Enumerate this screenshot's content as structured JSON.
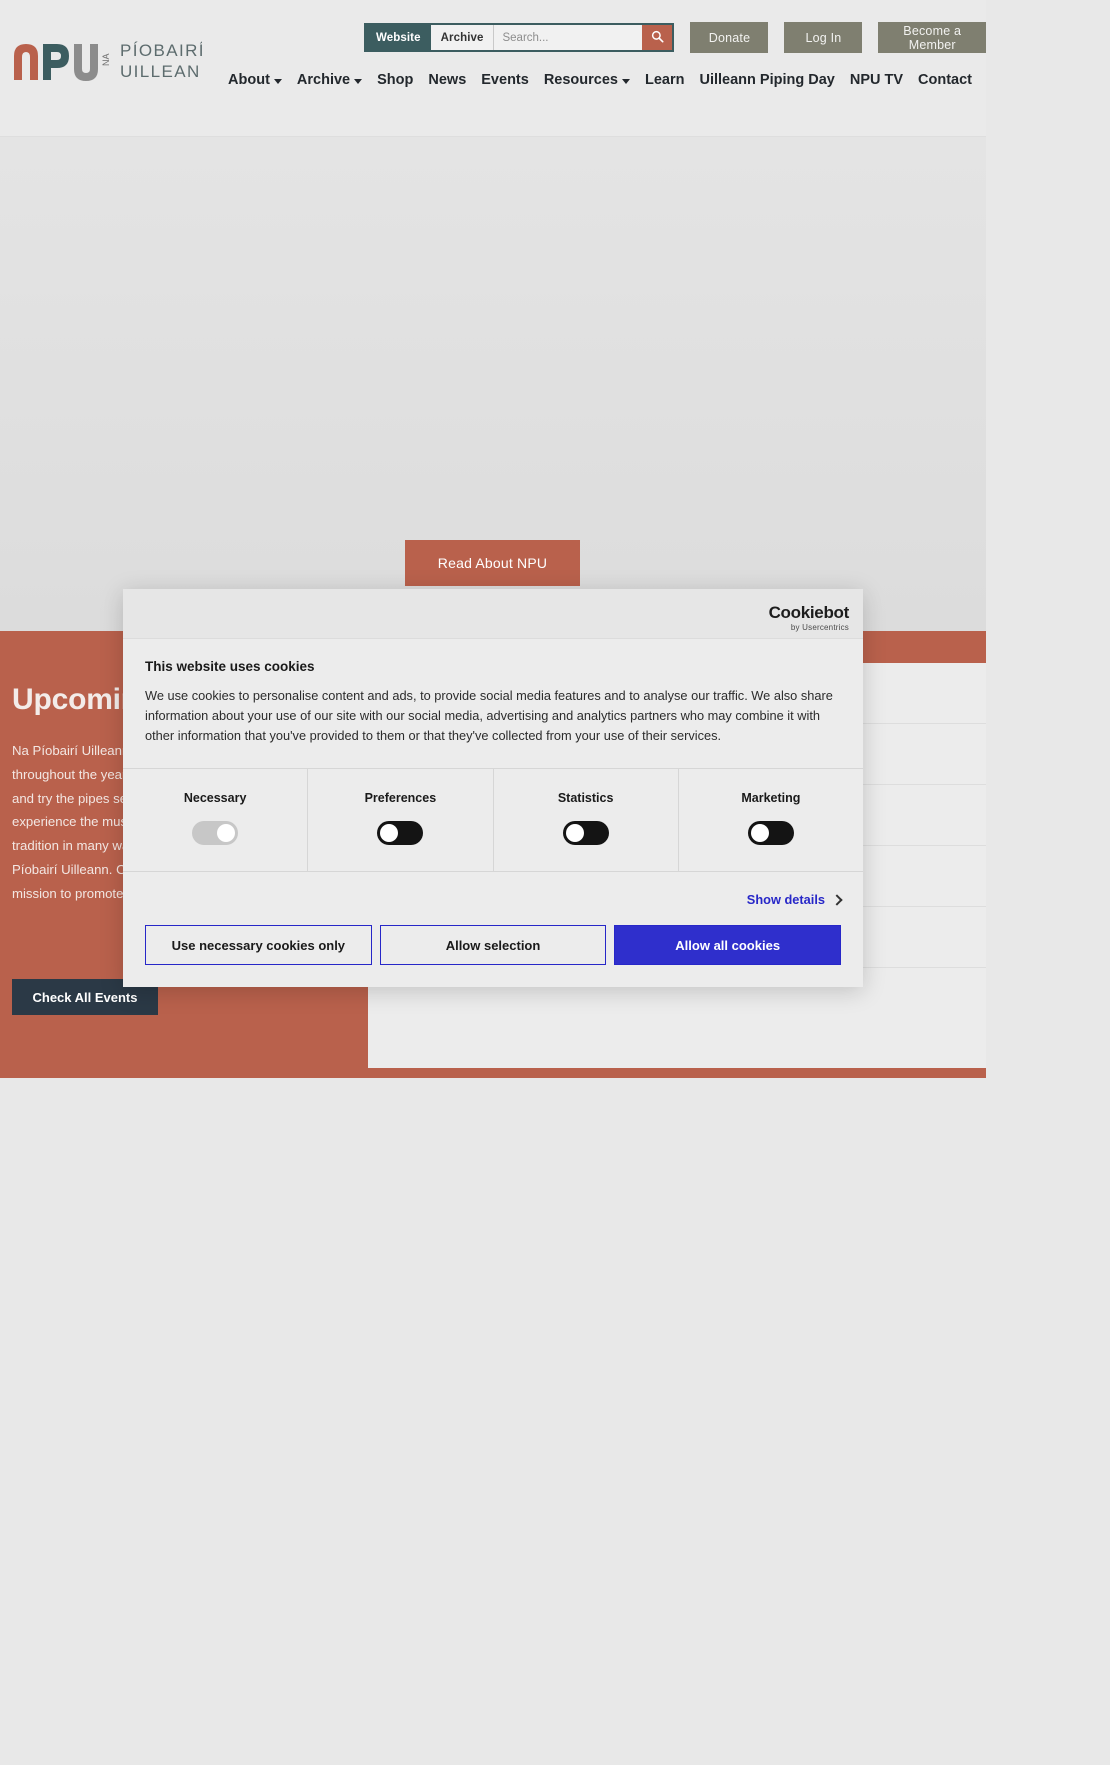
{
  "site": {
    "logo": {
      "abbr": "nPU",
      "na": "NA",
      "line1": "PÍOBAIRÍ",
      "line2": "UILLEANN"
    },
    "search": {
      "scope_website": "Website",
      "scope_archive": "Archive",
      "placeholder": "Search...",
      "value": "",
      "search_icon": "search-icon"
    },
    "buttons": {
      "donate": "Donate",
      "login": "Log In",
      "member": "Become a Member"
    },
    "nav": [
      {
        "label": "About",
        "caret": true
      },
      {
        "label": "Archive",
        "caret": true
      },
      {
        "label": "Shop",
        "caret": false
      },
      {
        "label": "News",
        "caret": false
      },
      {
        "label": "Events",
        "caret": false
      },
      {
        "label": "Resources",
        "caret": true
      },
      {
        "label": "Learn",
        "caret": false
      },
      {
        "label": "Uilleann Piping Day",
        "caret": false
      },
      {
        "label": "NPU TV",
        "caret": false
      },
      {
        "label": "Contact",
        "caret": false
      }
    ]
  },
  "hero": {
    "cta": "Read About NPU"
  },
  "events": {
    "title": "Upcoming Events",
    "copy": "Na Píobairí Uilleann hosts a wide variety of events throughout the year. From recitals and concerts to lectures and try the pipes sessions, our events allow audiences to experience the music of the uilleann pipes and the Irish tradition in many ways while also supporting the work of Na Píobairí Uilleann. Our events programming is reflective of our mission to promote uilleann piping and the Irish tradition.",
    "button": "Check All Events",
    "rows": [
      {
        "date": "",
        "name": ""
      },
      {
        "date": "",
        "name": ""
      },
      {
        "date": "",
        "name": ""
      },
      {
        "date": "",
        "name": ""
      },
      {
        "date": "",
        "name": ""
      },
      {
        "date": "",
        "name": ""
      }
    ]
  },
  "cookie": {
    "brand_main": "Cookiebot",
    "brand_sub": "by Usercentrics",
    "heading": "This website uses cookies",
    "paragraph": "We use cookies to personalise content and ads, to provide social media features and to analyse our traffic. We also share information about your use of our site with our social media, advertising and analytics partners who may combine it with other information that you've provided to them or that they've collected from your use of their services.",
    "categories": [
      {
        "label": "Necessary",
        "state": "on",
        "disabled": true
      },
      {
        "label": "Preferences",
        "state": "off",
        "disabled": false
      },
      {
        "label": "Statistics",
        "state": "off",
        "disabled": false
      },
      {
        "label": "Marketing",
        "state": "off",
        "disabled": false
      }
    ],
    "show_details": "Show details",
    "actions": {
      "necessary_only": "Use necessary cookies only",
      "allow_selection": "Allow selection",
      "allow_all": "Allow all cookies"
    },
    "colors": {
      "primary": "#2f2fcc",
      "link": "#2727c8",
      "toggle_off": "#141414",
      "toggle_disabled": "#c7c7c7"
    }
  },
  "colors": {
    "brand_terracotta": "#b9614c",
    "brand_teal": "#3c5d60",
    "brand_olive": "#7f7f70",
    "dark_navy": "#2b3946"
  }
}
